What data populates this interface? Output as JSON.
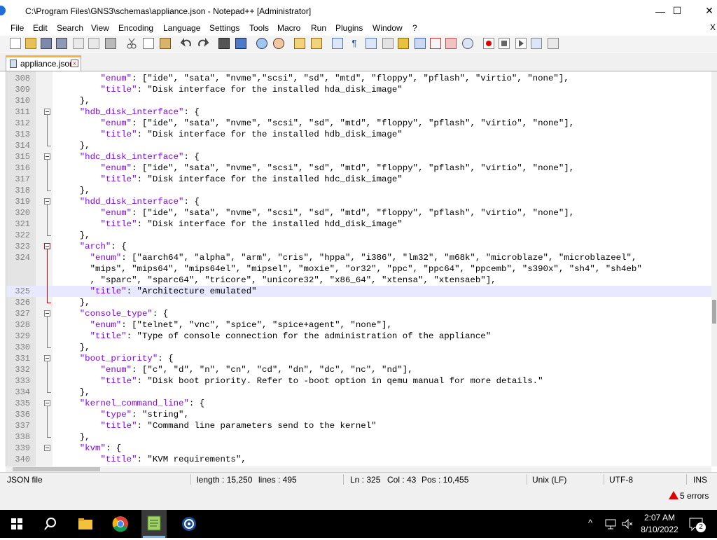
{
  "window": {
    "title": "C:\\Program Files\\GNS3\\schemas\\appliance.json - Notepad++ [Administrator]",
    "minimize_icon": "—",
    "maximize_icon": "☐",
    "close_icon": "✕"
  },
  "menu": [
    "File",
    "Edit",
    "Search",
    "View",
    "Encoding",
    "Language",
    "Settings",
    "Tools",
    "Macro",
    "Run",
    "Plugins",
    "Window",
    "?"
  ],
  "menu_close": "X",
  "toolbar": [
    "new-file-icon",
    "open-file-icon",
    "save-icon",
    "save-all-icon",
    "close-icon",
    "close-all-icon",
    "print-icon",
    "cut-icon",
    "copy-icon",
    "paste-icon",
    "undo-icon",
    "redo-icon",
    "find-icon",
    "replace-icon",
    "zoom-in-icon",
    "zoom-out-icon",
    "sync-vertical-icon",
    "sync-horizontal-icon",
    "word-wrap-icon",
    "show-all-chars-icon",
    "indent-guide-icon",
    "user-language-icon",
    "document-map-icon",
    "function-list-icon",
    "folder-workspace-icon",
    "monitor-icon",
    "record-macro-icon",
    "stop-macro-icon",
    "play-macro-icon",
    "run-macro-multiple-icon",
    "save-macro-icon"
  ],
  "tab": {
    "label": "appliance.json",
    "close": "x"
  },
  "editor": {
    "lines": [
      {
        "n": "308",
        "fold": "",
        "code": [
          [
            "",
            "        "
          ],
          [
            "key",
            "\"enum\""
          ],
          [
            "str",
            ": [\"ide\", \"sata\", \"nvme\",\"scsi\", \"sd\", \"mtd\", \"floppy\", \"pflash\", \"virtio\", \"none\"],"
          ]
        ]
      },
      {
        "n": "309",
        "fold": "",
        "code": [
          [
            "",
            "        "
          ],
          [
            "key",
            "\"title\""
          ],
          [
            "str",
            ": \"Disk interface for the installed hda_disk_image\""
          ]
        ]
      },
      {
        "n": "310",
        "fold": "end",
        "code": [
          [
            "str",
            "    },"
          ]
        ]
      },
      {
        "n": "311",
        "fold": "open",
        "code": [
          [
            "",
            "    "
          ],
          [
            "key",
            "\"hdb_disk_interface\""
          ],
          [
            "str",
            ": {"
          ]
        ]
      },
      {
        "n": "312",
        "fold": "",
        "code": [
          [
            "",
            "        "
          ],
          [
            "key",
            "\"enum\""
          ],
          [
            "str",
            ": [\"ide\", \"sata\", \"nvme\", \"scsi\", \"sd\", \"mtd\", \"floppy\", \"pflash\", \"virtio\", \"none\"],"
          ]
        ]
      },
      {
        "n": "313",
        "fold": "",
        "code": [
          [
            "",
            "        "
          ],
          [
            "key",
            "\"title\""
          ],
          [
            "str",
            ": \"Disk interface for the installed hdb_disk_image\""
          ]
        ]
      },
      {
        "n": "314",
        "fold": "end",
        "code": [
          [
            "str",
            "    },"
          ]
        ]
      },
      {
        "n": "315",
        "fold": "open",
        "code": [
          [
            "",
            "    "
          ],
          [
            "key",
            "\"hdc_disk_interface\""
          ],
          [
            "str",
            ": {"
          ]
        ]
      },
      {
        "n": "316",
        "fold": "",
        "code": [
          [
            "",
            "        "
          ],
          [
            "key",
            "\"enum\""
          ],
          [
            "str",
            ": [\"ide\", \"sata\", \"nvme\", \"scsi\", \"sd\", \"mtd\", \"floppy\", \"pflash\", \"virtio\", \"none\"],"
          ]
        ]
      },
      {
        "n": "317",
        "fold": "",
        "code": [
          [
            "",
            "        "
          ],
          [
            "key",
            "\"title\""
          ],
          [
            "str",
            ": \"Disk interface for the installed hdc_disk_image\""
          ]
        ]
      },
      {
        "n": "318",
        "fold": "end",
        "code": [
          [
            "str",
            "    },"
          ]
        ]
      },
      {
        "n": "319",
        "fold": "open",
        "code": [
          [
            "",
            "    "
          ],
          [
            "key",
            "\"hdd_disk_interface\""
          ],
          [
            "str",
            ": {"
          ]
        ]
      },
      {
        "n": "320",
        "fold": "",
        "code": [
          [
            "",
            "        "
          ],
          [
            "key",
            "\"enum\""
          ],
          [
            "str",
            ": [\"ide\", \"sata\", \"nvme\", \"scsi\", \"sd\", \"mtd\", \"floppy\", \"pflash\", \"virtio\", \"none\"],"
          ]
        ]
      },
      {
        "n": "321",
        "fold": "",
        "code": [
          [
            "",
            "        "
          ],
          [
            "key",
            "\"title\""
          ],
          [
            "str",
            ": \"Disk interface for the installed hdd_disk_image\""
          ]
        ]
      },
      {
        "n": "322",
        "fold": "end",
        "code": [
          [
            "str",
            "    },"
          ]
        ]
      },
      {
        "n": "323",
        "fold": "open-red",
        "code": [
          [
            "",
            "    "
          ],
          [
            "key",
            "\"arch\""
          ],
          [
            "str",
            ": {"
          ]
        ]
      },
      {
        "n": "324",
        "fold": "",
        "code": [
          [
            "",
            "      "
          ],
          [
            "key",
            "\"enum\""
          ],
          [
            "str",
            ": [\"aarch64\", \"alpha\", \"arm\", \"cris\", \"hppa\", \"i386\", \"lm32\", \"m68k\", \"microblaze\", \"microblazeel\","
          ]
        ]
      },
      {
        "n": "",
        "fold": "",
        "code": [
          [
            "str",
            "      \"mips\", \"mips64\", \"mips64el\", \"mipsel\", \"moxie\", \"or32\", \"ppc\", \"ppc64\", \"ppcemb\", \"s390x\", \"sh4\", \"sh4eb\""
          ]
        ]
      },
      {
        "n": "",
        "fold": "",
        "code": [
          [
            "str",
            "      , \"sparc\", \"sparc64\", \"tricore\", \"unicore32\", \"x86_64\", \"xtensa\", \"xtensaeb\"],"
          ]
        ]
      },
      {
        "n": "325",
        "fold": "",
        "current": true,
        "code": [
          [
            "",
            "      "
          ],
          [
            "key",
            "\"title\""
          ],
          [
            "str",
            ": \"Architecture emulated\""
          ]
        ]
      },
      {
        "n": "326",
        "fold": "end-red",
        "code": [
          [
            "str",
            "    },"
          ]
        ]
      },
      {
        "n": "327",
        "fold": "open",
        "code": [
          [
            "",
            "    "
          ],
          [
            "key",
            "\"console_type\""
          ],
          [
            "str",
            ": {"
          ]
        ]
      },
      {
        "n": "328",
        "fold": "",
        "code": [
          [
            "",
            "      "
          ],
          [
            "key",
            "\"enum\""
          ],
          [
            "str",
            ": [\"telnet\", \"vnc\", \"spice\", \"spice+agent\", \"none\"],"
          ]
        ]
      },
      {
        "n": "329",
        "fold": "",
        "code": [
          [
            "",
            "      "
          ],
          [
            "key",
            "\"title\""
          ],
          [
            "str",
            ": \"Type of console connection for the administration of the appliance\""
          ]
        ]
      },
      {
        "n": "330",
        "fold": "end",
        "code": [
          [
            "str",
            "    },"
          ]
        ]
      },
      {
        "n": "331",
        "fold": "open",
        "code": [
          [
            "",
            "    "
          ],
          [
            "key",
            "\"boot_priority\""
          ],
          [
            "str",
            ": {"
          ]
        ]
      },
      {
        "n": "332",
        "fold": "",
        "code": [
          [
            "",
            "        "
          ],
          [
            "key",
            "\"enum\""
          ],
          [
            "str",
            ": [\"c\", \"d\", \"n\", \"cn\", \"cd\", \"dn\", \"dc\", \"nc\", \"nd\"],"
          ]
        ]
      },
      {
        "n": "333",
        "fold": "",
        "code": [
          [
            "",
            "        "
          ],
          [
            "key",
            "\"title\""
          ],
          [
            "str",
            ": \"Disk boot priority. Refer to -boot option in qemu manual for more details.\""
          ]
        ]
      },
      {
        "n": "334",
        "fold": "end",
        "code": [
          [
            "str",
            "    },"
          ]
        ]
      },
      {
        "n": "335",
        "fold": "open",
        "code": [
          [
            "",
            "    "
          ],
          [
            "key",
            "\"kernel_command_line\""
          ],
          [
            "str",
            ": {"
          ]
        ]
      },
      {
        "n": "336",
        "fold": "",
        "code": [
          [
            "",
            "        "
          ],
          [
            "key",
            "\"type\""
          ],
          [
            "str",
            ": \"string\","
          ]
        ]
      },
      {
        "n": "337",
        "fold": "",
        "code": [
          [
            "",
            "        "
          ],
          [
            "key",
            "\"title\""
          ],
          [
            "str",
            ": \"Command line parameters send to the kernel\""
          ]
        ]
      },
      {
        "n": "338",
        "fold": "end",
        "code": [
          [
            "str",
            "    },"
          ]
        ]
      },
      {
        "n": "339",
        "fold": "open",
        "code": [
          [
            "",
            "    "
          ],
          [
            "key",
            "\"kvm\""
          ],
          [
            "str",
            ": {"
          ]
        ]
      },
      {
        "n": "340",
        "fold": "",
        "code": [
          [
            "",
            "        "
          ],
          [
            "key",
            "\"title\""
          ],
          [
            "str",
            ": \"KVM requirements\","
          ]
        ]
      }
    ]
  },
  "status": {
    "filetype": "JSON file",
    "length": "length : 15,250",
    "lines": "lines : 495",
    "ln": "Ln : 325",
    "col": "Col : 43",
    "pos": "Pos : 10,455",
    "eol": "Unix (LF)",
    "encoding": "UTF-8",
    "mode": "INS"
  },
  "errors": {
    "label": "5 errors"
  },
  "taskbar": {
    "time": "2:07 AM",
    "date": "8/10/2022",
    "notification_count": "2"
  },
  "colors": {
    "key": "#8000ff",
    "current_line": "#e8e8ff",
    "fold_red": "#dd0000"
  }
}
